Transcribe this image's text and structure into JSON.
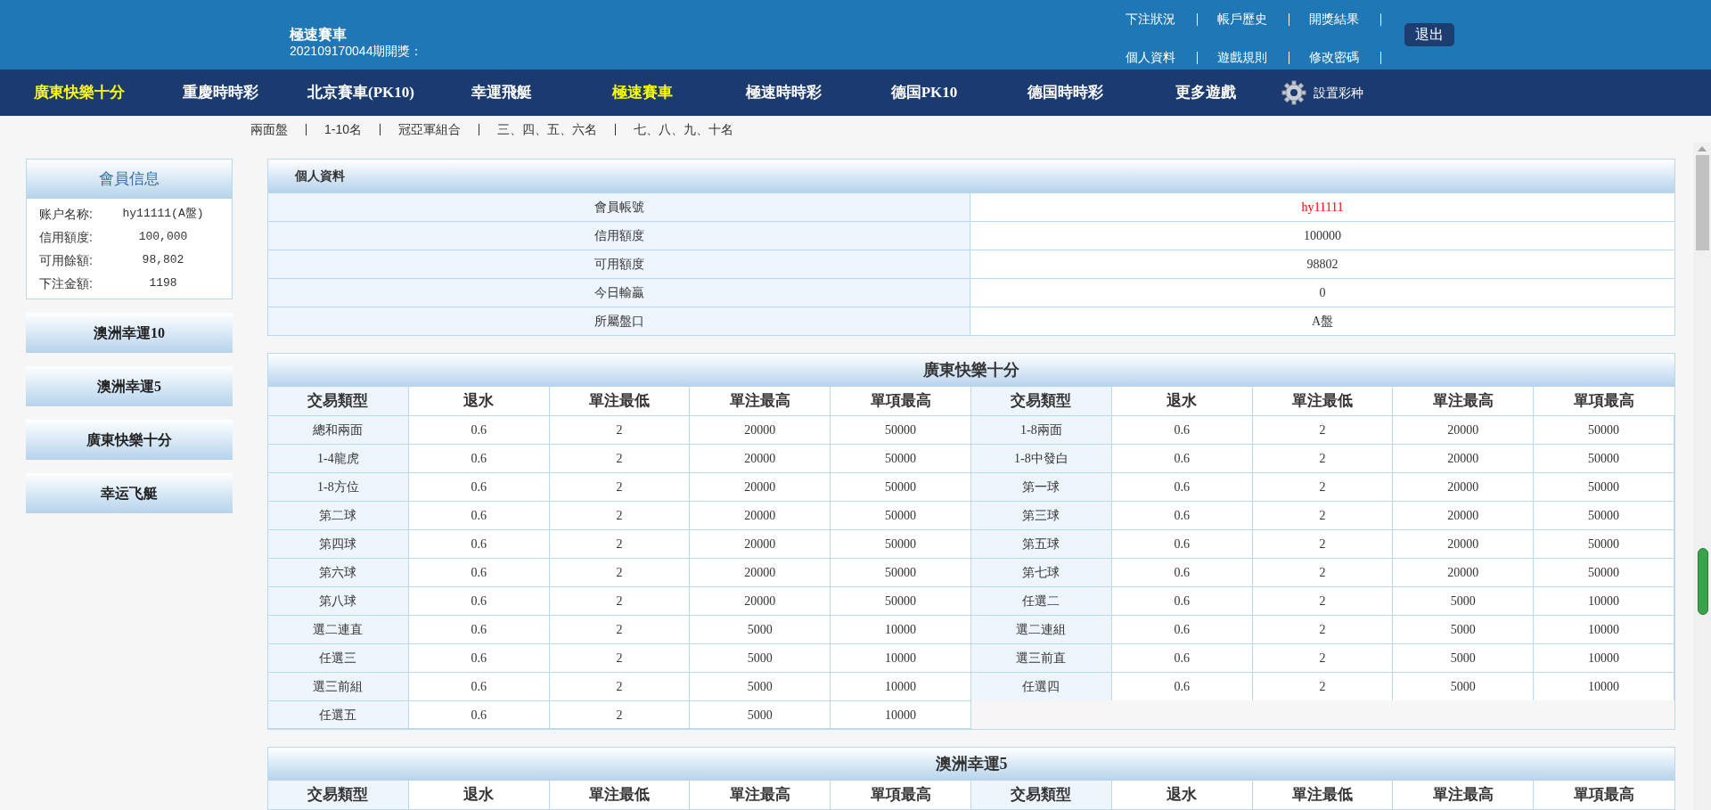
{
  "header": {
    "title": "極速賽車",
    "draw_info": "202109170044期開獎：",
    "links_row_1": [
      "下注狀況",
      "帳戶歷史",
      "開獎結果"
    ],
    "links_row_2": [
      "個人資料",
      "遊戲規則",
      "修改密碼"
    ],
    "logout": "退出"
  },
  "nav": {
    "items": [
      {
        "label": "廣東快樂十分",
        "selected": true
      },
      {
        "label": "重慶時時彩",
        "selected": false
      },
      {
        "label": "北京賽車(PK10)",
        "selected": false
      },
      {
        "label": "幸運飛艇",
        "selected": false
      },
      {
        "label": "極速賽車",
        "selected": true
      },
      {
        "label": "極速時時彩",
        "selected": false
      },
      {
        "label": "德国PK10",
        "selected": false
      },
      {
        "label": "德国時時彩",
        "selected": false
      },
      {
        "label": "更多遊戲",
        "selected": false
      }
    ],
    "settings": "設置彩种"
  },
  "subnav": [
    "兩面盤",
    "1-10名",
    "冠亞軍組合",
    "三、四、五、六名",
    "七、八、九、十名"
  ],
  "sidebar": {
    "title": "會員信息",
    "rows": [
      {
        "label": "账户名称:",
        "value": "hy11111(A盤)"
      },
      {
        "label": "信用額度:",
        "value": "100,000"
      },
      {
        "label": "可用餘額:",
        "value": "98,802"
      },
      {
        "label": "下注金額:",
        "value": "1198"
      }
    ],
    "games": [
      "澳洲幸運10",
      "澳洲幸運5",
      "廣東快樂十分",
      "幸运飞艇"
    ]
  },
  "profile": {
    "title": "個人資料",
    "rows": [
      {
        "label": "會員帳號",
        "value": "hy11111",
        "emphasis": true
      },
      {
        "label": "信用額度",
        "value": "100000",
        "emphasis": false
      },
      {
        "label": "可用額度",
        "value": "98802",
        "emphasis": false
      },
      {
        "label": "今日輸贏",
        "value": "0",
        "emphasis": false
      },
      {
        "label": "所屬盤口",
        "value": "A盤",
        "emphasis": false
      }
    ]
  },
  "limit_tables": [
    {
      "title": "廣東快樂十分",
      "columns": [
        "交易類型",
        "退水",
        "單注最低",
        "單注最高",
        "單項最高",
        "交易類型",
        "退水",
        "單注最低",
        "單注最高",
        "單項最高"
      ],
      "rows": [
        [
          "總和兩面",
          "0.6",
          "2",
          "20000",
          "50000",
          "1-8兩面",
          "0.6",
          "2",
          "20000",
          "50000"
        ],
        [
          "1-4龍虎",
          "0.6",
          "2",
          "20000",
          "50000",
          "1-8中發白",
          "0.6",
          "2",
          "20000",
          "50000"
        ],
        [
          "1-8方位",
          "0.6",
          "2",
          "20000",
          "50000",
          "第一球",
          "0.6",
          "2",
          "20000",
          "50000"
        ],
        [
          "第二球",
          "0.6",
          "2",
          "20000",
          "50000",
          "第三球",
          "0.6",
          "2",
          "20000",
          "50000"
        ],
        [
          "第四球",
          "0.6",
          "2",
          "20000",
          "50000",
          "第五球",
          "0.6",
          "2",
          "20000",
          "50000"
        ],
        [
          "第六球",
          "0.6",
          "2",
          "20000",
          "50000",
          "第七球",
          "0.6",
          "2",
          "20000",
          "50000"
        ],
        [
          "第八球",
          "0.6",
          "2",
          "20000",
          "50000",
          "任選二",
          "0.6",
          "2",
          "5000",
          "10000"
        ],
        [
          "選二連直",
          "0.6",
          "2",
          "5000",
          "10000",
          "選二連組",
          "0.6",
          "2",
          "5000",
          "10000"
        ],
        [
          "任選三",
          "0.6",
          "2",
          "5000",
          "10000",
          "選三前直",
          "0.6",
          "2",
          "5000",
          "10000"
        ],
        [
          "選三前組",
          "0.6",
          "2",
          "5000",
          "10000",
          "任選四",
          "0.6",
          "2",
          "5000",
          "10000"
        ],
        [
          "任選五",
          "0.6",
          "2",
          "5000",
          "10000"
        ]
      ]
    },
    {
      "title": "澳洲幸運5",
      "columns": [
        "交易類型",
        "退水",
        "單注最低",
        "單注最高",
        "單項最高",
        "交易類型",
        "退水",
        "單注最低",
        "單注最高",
        "單項最高"
      ]
    }
  ]
}
